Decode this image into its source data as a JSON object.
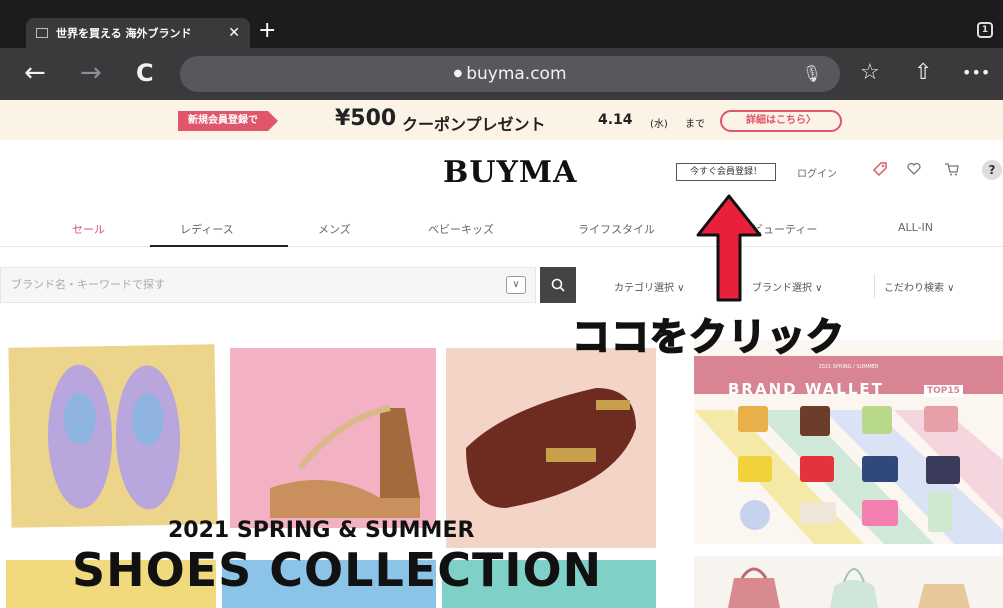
{
  "browser": {
    "tab_title": "世界を買える 海外ブランド",
    "tab_close": "✕",
    "new_tab": "+",
    "tab_count": "1",
    "url": "buyma.com",
    "back": "←",
    "forward": "→",
    "reload": "C",
    "mic": "🎙",
    "bookmark": "☆",
    "share": "⇧",
    "more": "•••"
  },
  "coupon": {
    "tag": "新規会員登録で",
    "amount": "¥500",
    "text": "クーポンプレゼント",
    "date": "4.14",
    "weekday": "(水)",
    "until": "まで",
    "detail_button": "詳細はこちら〉"
  },
  "header": {
    "logo": "BUYMA",
    "register_button": "今すぐ会員登録！",
    "login": "ログイン",
    "icons": [
      "tag-icon",
      "heart-icon",
      "cart-icon",
      "help-icon"
    ],
    "help": "?"
  },
  "nav": {
    "items": [
      "セール",
      "レディース",
      "メンズ",
      "ベビーキッズ",
      "ライフスタイル",
      "ビューティー",
      "ALL-IN"
    ],
    "active": "レディース",
    "sale_color": "#e0566a"
  },
  "search": {
    "placeholder": "ブランド名・キーワードで探す",
    "dropdown": "∨",
    "button": "⌕",
    "filters": [
      "カテゴリ選択 ∨",
      "ブランド選択 ∨",
      "こだわり検索 ∨"
    ]
  },
  "annotation": {
    "text": "ココをクリック",
    "color": "#e8203a"
  },
  "hero": {
    "subtitle": "2021 SPRING & SUMMER",
    "title": "SHOES COLLECTION"
  },
  "side_banner": {
    "kicker": "2021 SPRING / SUMMER",
    "title": "BRAND WALLET",
    "badge": "TOP15",
    "accent": "#d98493"
  }
}
